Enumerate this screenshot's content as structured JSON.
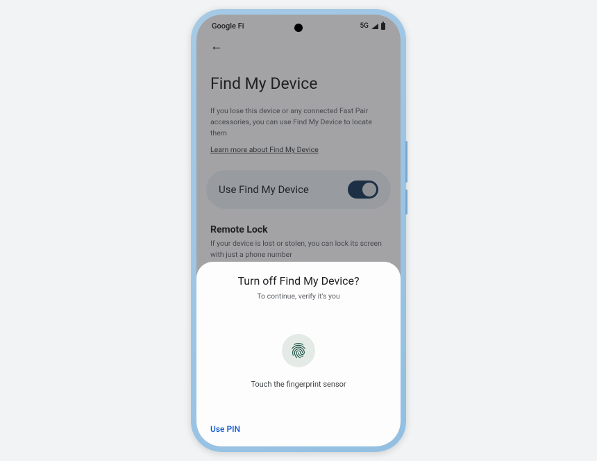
{
  "status_bar": {
    "carrier": "Google Fi",
    "network": "5G"
  },
  "page": {
    "title": "Find My Device",
    "description": "If you lose this device or any connected Fast Pair accessories, you can use Find My Device to locate them",
    "learn_more": "Learn more about Find My Device"
  },
  "toggle": {
    "label": "Use Find My Device",
    "on": true
  },
  "remote_lock": {
    "title": "Remote Lock",
    "description": "If your device is lost or stolen, you can lock its screen with just a phone number"
  },
  "dialog": {
    "title": "Turn off Find My Device?",
    "subtitle": "To continue, verify it's you",
    "prompt": "Touch the fingerprint sensor",
    "use_pin": "Use PIN"
  }
}
